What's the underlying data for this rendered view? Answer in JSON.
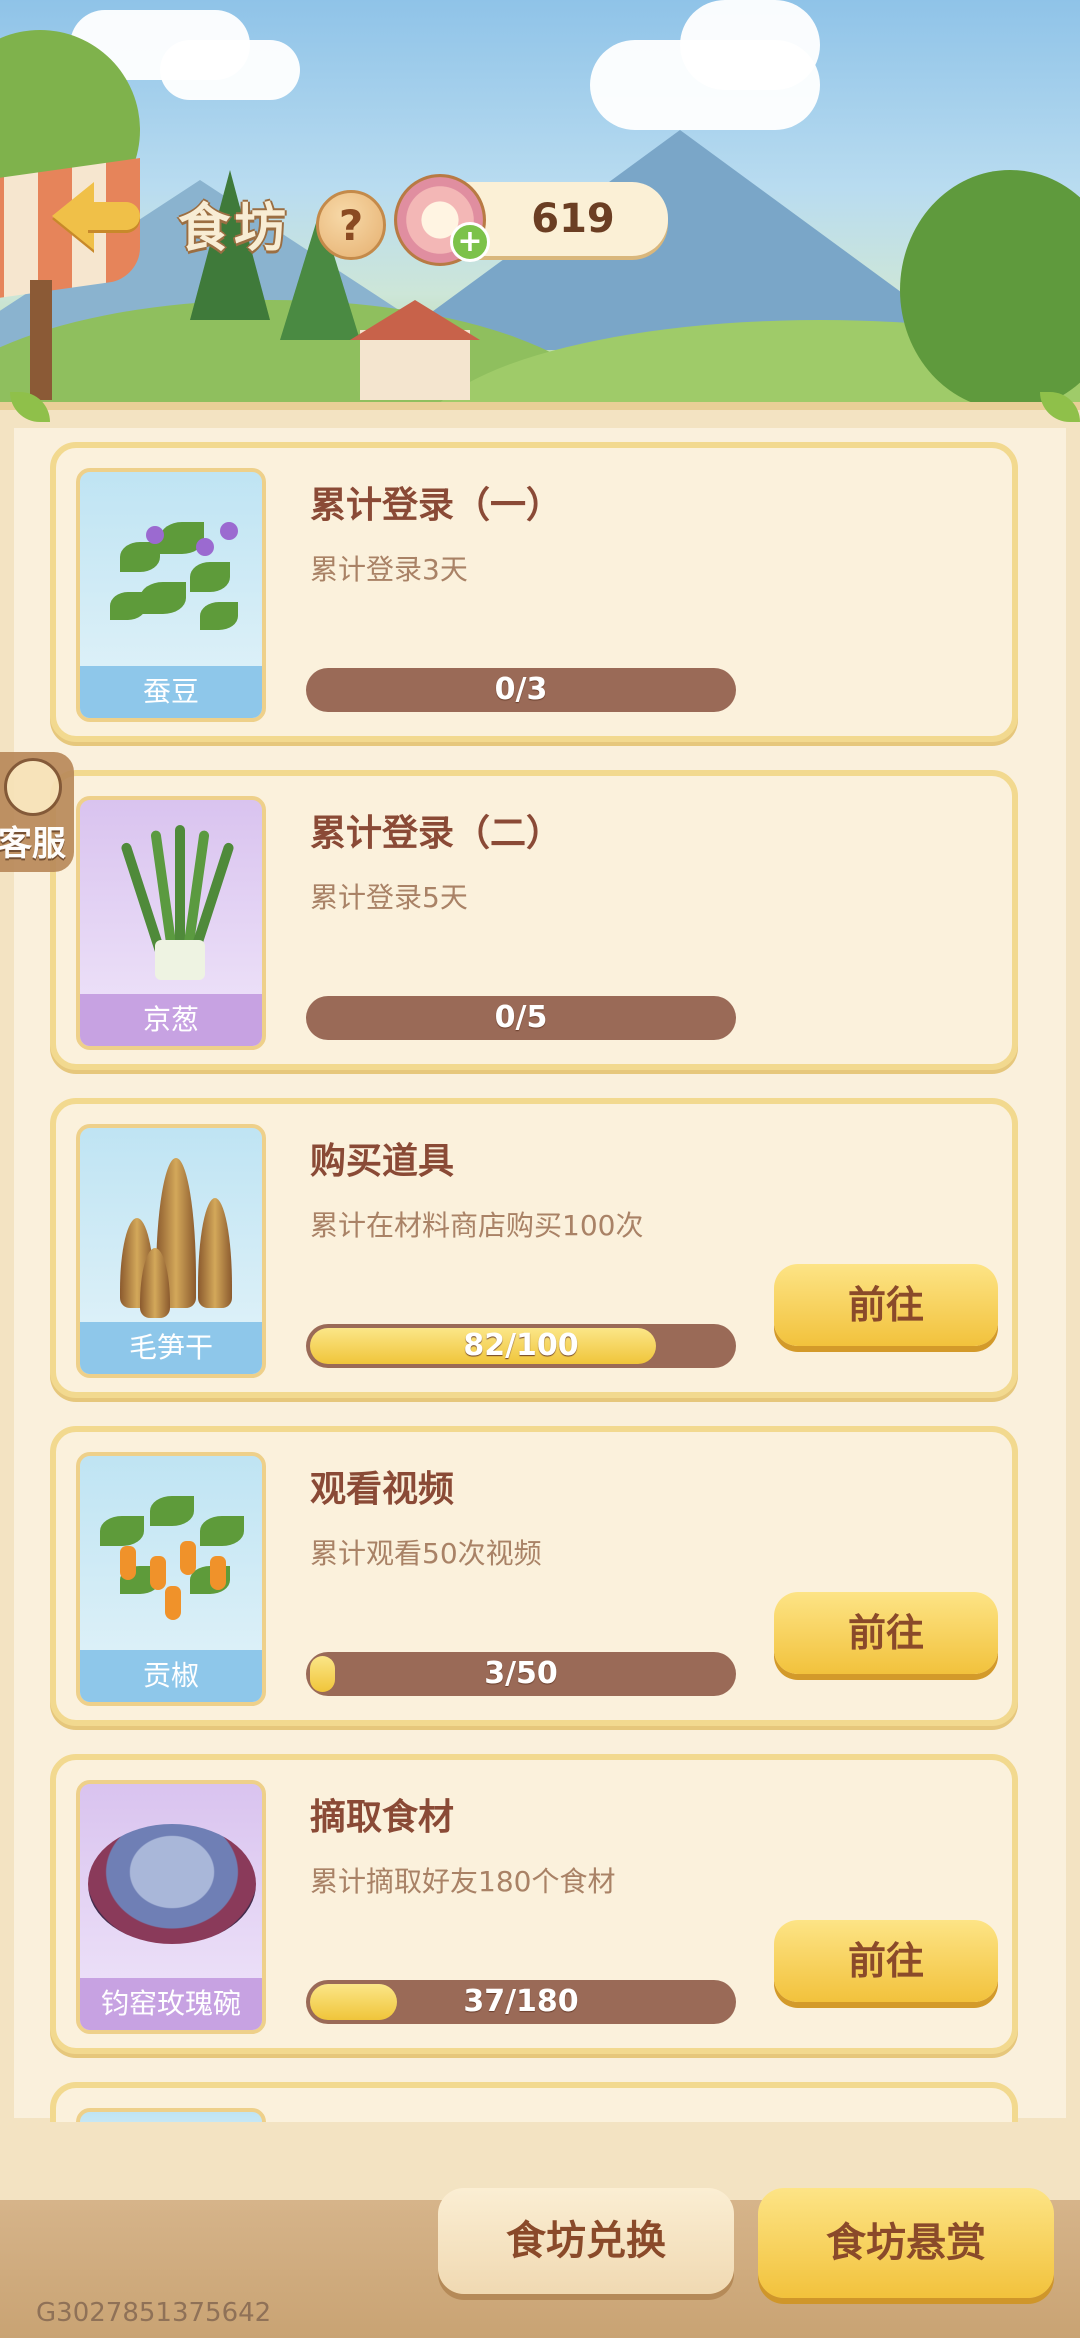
{
  "header": {
    "title": "食坊",
    "help_label": "?",
    "currency_value": "619",
    "currency_plus": "+"
  },
  "tasks": [
    {
      "title": "累计登录（一）",
      "desc": "累计登录3天",
      "progress_label": "0/3",
      "progress": 0.0,
      "item_name": "蚕豆",
      "thumb_bg": "blue",
      "button": ""
    },
    {
      "title": "累计登录（二）",
      "desc": "累计登录5天",
      "progress_label": "0/5",
      "progress": 0.0,
      "item_name": "京葱",
      "thumb_bg": "purple",
      "button": ""
    },
    {
      "title": "购买道具",
      "desc": "累计在材料商店购买100次",
      "progress_label": "82/100",
      "progress": 0.82,
      "item_name": "毛笋干",
      "thumb_bg": "blue",
      "button": "前往"
    },
    {
      "title": "观看视频",
      "desc": "累计观看50次视频",
      "progress_label": "3/50",
      "progress": 0.06,
      "item_name": "贡椒",
      "thumb_bg": "blue",
      "button": "前往"
    },
    {
      "title": "摘取食材",
      "desc": "累计摘取好友180个食材",
      "progress_label": "37/180",
      "progress": 0.205,
      "item_name": "钧窑玫瑰碗",
      "thumb_bg": "purple",
      "button": "前往"
    }
  ],
  "service": {
    "label": "客服"
  },
  "bottom_tabs": {
    "exchange": "食坊兑换",
    "reward": "食坊悬赏"
  },
  "footer": {
    "id_text": "G3027851375642"
  },
  "colors": {
    "accent_yellow": "#f2c23c",
    "title_brown": "#8a4a36",
    "progress_track": "#9a6a57"
  }
}
